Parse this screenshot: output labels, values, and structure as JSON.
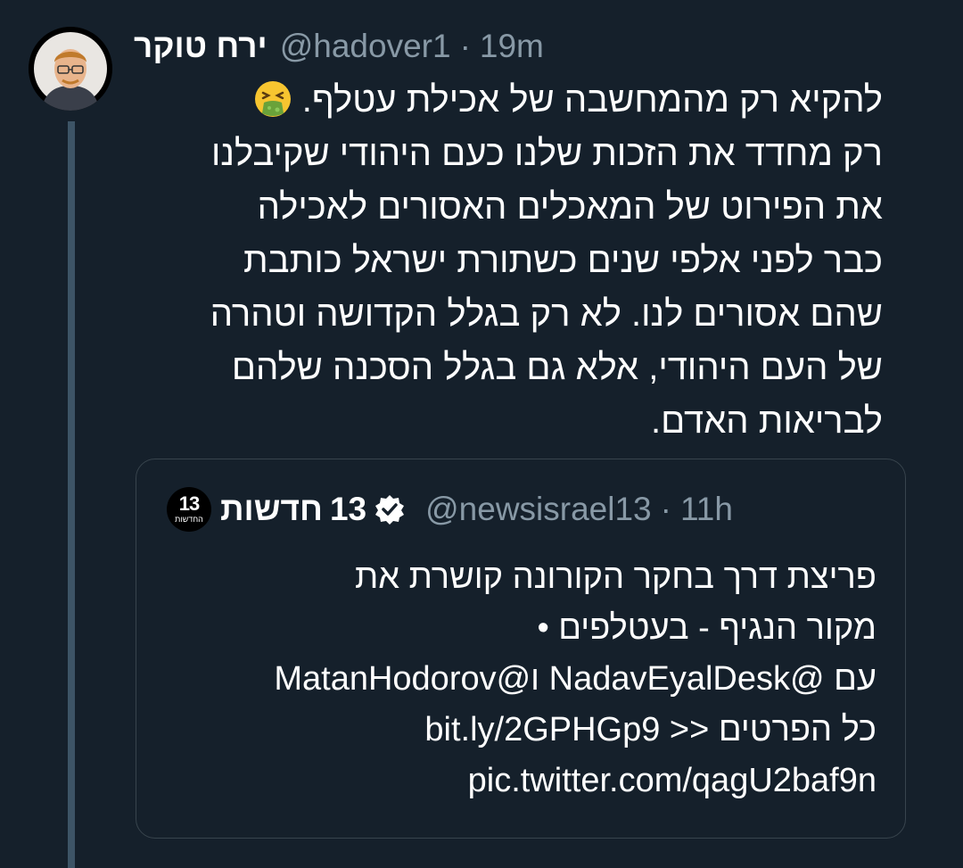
{
  "tweet": {
    "author_name": "ירח טוקר",
    "handle": "@hadover1",
    "separator": "·",
    "time": "19m",
    "avatar_icon": "user-avatar-photo",
    "emoji_icon": "nauseated-vomiting-face-emoji",
    "lines": [
      "להקיא רק מהמחשבה של אכילת עטלף.",
      "רק מחדד את הזכות שלנו כעם היהודי שקיבלנו",
      "את הפירוט של המאכלים האסורים לאכילה",
      "כבר לפני אלפי שנים כשתורת ישראל כותבת",
      "שהם אסורים לנו. לא רק בגלל הקדושה וטהרה",
      "של העם היהודי, אלא גם בגלל הסכנה שלהם",
      "לבריאות האדם."
    ]
  },
  "quote": {
    "logo_text": "13",
    "logo_sub": "החדשות",
    "name_text": "חדשות",
    "name_num": "13",
    "verified_icon": "verified-badge-icon",
    "handle": "@newsisrael13",
    "separator": "·",
    "time": "11h",
    "lines": [
      "פריצת דרך בחקר הקורונה קושרת את",
      "מקור הנגיף - בעטלפים •",
      "עם @NadavEyalDesk ו@MatanHodorov",
      "כל הפרטים << bit.ly/2GPHGp9",
      "pic.twitter.com/qagU2baf9n"
    ]
  },
  "colors": {
    "background": "#15202b",
    "text": "#ffffff",
    "secondary_text": "#8899a6",
    "border": "#38444d",
    "thread_line": "#3d5466"
  }
}
